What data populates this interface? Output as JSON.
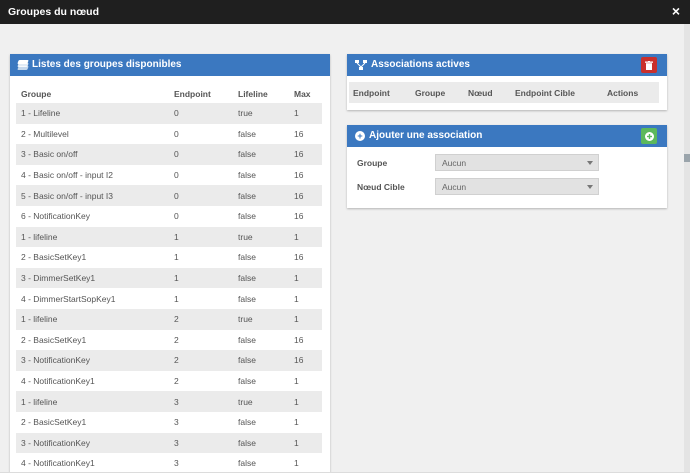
{
  "dialog": {
    "title": "Groupes du nœud",
    "close_label": "×"
  },
  "groups_panel": {
    "title": "Listes des groupes disponibles",
    "columns": [
      "Groupe",
      "Endpoint",
      "Lifeline",
      "Max"
    ],
    "rows": [
      [
        "1 - Lifeline",
        "0",
        "true",
        "1"
      ],
      [
        "2 - Multilevel",
        "0",
        "false",
        "16"
      ],
      [
        "3 - Basic on/off",
        "0",
        "false",
        "16"
      ],
      [
        "4 - Basic on/off - input I2",
        "0",
        "false",
        "16"
      ],
      [
        "5 - Basic on/off - input I3",
        "0",
        "false",
        "16"
      ],
      [
        "6 - NotificationKey",
        "0",
        "false",
        "16"
      ],
      [
        "1 - lifeline",
        "1",
        "true",
        "1"
      ],
      [
        "2 - BasicSetKey1",
        "1",
        "false",
        "16"
      ],
      [
        "3 - DimmerSetKey1",
        "1",
        "false",
        "1"
      ],
      [
        "4 - DimmerStartSopKey1",
        "1",
        "false",
        "1"
      ],
      [
        "1 - lifeline",
        "2",
        "true",
        "1"
      ],
      [
        "2 - BasicSetKey1",
        "2",
        "false",
        "16"
      ],
      [
        "3 - NotificationKey",
        "2",
        "false",
        "16"
      ],
      [
        "4 - NotificationKey1",
        "2",
        "false",
        "1"
      ],
      [
        "1 - lifeline",
        "3",
        "true",
        "1"
      ],
      [
        "2 - BasicSetKey1",
        "3",
        "false",
        "1"
      ],
      [
        "3 - NotificationKey",
        "3",
        "false",
        "1"
      ],
      [
        "4 - NotificationKey1",
        "3",
        "false",
        "1"
      ]
    ]
  },
  "associations_panel": {
    "title": "Associations actives",
    "columns": [
      "Endpoint",
      "Groupe",
      "Nœud",
      "Endpoint Cible",
      "Actions"
    ],
    "delete_icon": "trash-icon",
    "delete_color": "#c9302c"
  },
  "add_panel": {
    "title": "Ajouter une association",
    "add_icon": "plus-icon",
    "add_color": "#5cb85c",
    "group_label": "Groupe",
    "group_value": "Aucun",
    "target_label": "Nœud Cible",
    "target_value": "Aucun"
  },
  "colors": {
    "header_blue": "#3b78c0",
    "titlebar": "#1f1f1f"
  }
}
